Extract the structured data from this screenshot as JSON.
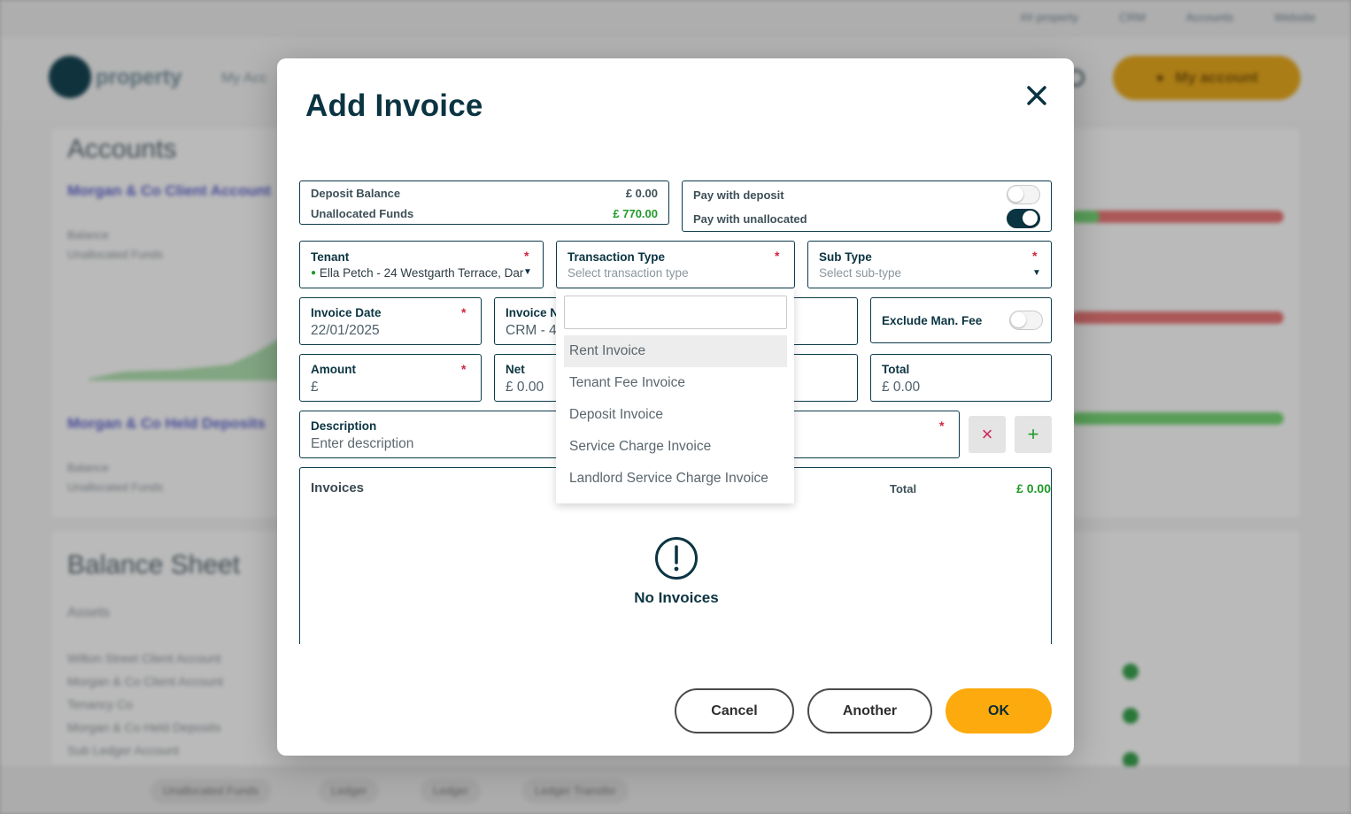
{
  "background": {
    "top_links": [
      "## property",
      "CRM",
      "Accounts",
      "Website"
    ],
    "logo_text": "property",
    "nav_item": "My Acc",
    "account_button": "My account",
    "accounts_title": "Accounts",
    "account1_name": "Morgan & Co Client Account",
    "account2_name": "Morgan & Co Held Deposits",
    "balance_sheet_title": "Balance Sheet",
    "assets_label": "Assets",
    "bottom_chips": [
      "Unallocated Funds",
      "Ledger",
      "Ledger",
      "Ledger Transfer"
    ]
  },
  "modal": {
    "title": "Add Invoice",
    "close_icon": "close-icon",
    "balances": {
      "deposit_label": "Deposit Balance",
      "deposit_value": "£ 0.00",
      "unallocated_label": "Unallocated Funds",
      "unallocated_value": "£ 770.00"
    },
    "pay_options": {
      "with_deposit_label": "Pay with deposit",
      "with_deposit_on": false,
      "with_unallocated_label": "Pay with unallocated",
      "with_unallocated_on": true
    },
    "tenant": {
      "label": "Tenant",
      "value": "Ella Petch - 24 Westgarth Terrace, Dar"
    },
    "transaction_type": {
      "label": "Transaction Type",
      "placeholder": "Select transaction type"
    },
    "sub_type": {
      "label": "Sub Type",
      "placeholder": "Select sub-type"
    },
    "invoice_date": {
      "label": "Invoice Date",
      "value": "22/01/2025"
    },
    "invoice_number": {
      "label": "Invoice N",
      "value": "CRM - 4"
    },
    "exclude_fee": {
      "label": "Exclude Man. Fee",
      "on": false
    },
    "amount": {
      "label": "Amount",
      "value": "£"
    },
    "net": {
      "label": "Net",
      "value": "£ 0.00"
    },
    "total_field": {
      "label": "Total",
      "value": "£ 0.00"
    },
    "description": {
      "label": "Description",
      "placeholder": "Enter description"
    },
    "required_mark": "*",
    "dropdown_options": [
      "Rent Invoice",
      "Tenant Fee Invoice",
      "Deposit Invoice",
      "Service Charge Invoice",
      "Landlord Service Charge Invoice"
    ],
    "invoices_panel": {
      "title": "Invoices",
      "total_label": "Total",
      "total_value": "£ 0.00",
      "empty_text": "No Invoices"
    },
    "buttons": {
      "cancel": "Cancel",
      "another": "Another",
      "ok": "OK"
    },
    "colors": {
      "accent": "#fdaa0e",
      "primary": "#0b3442",
      "required": "#d0263f",
      "positive": "#1f9a2a"
    }
  }
}
